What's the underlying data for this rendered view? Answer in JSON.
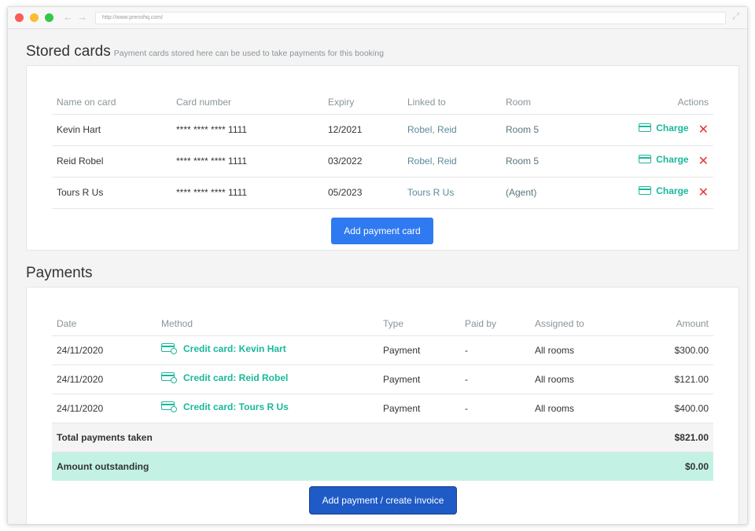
{
  "browser": {
    "url": "http://www.prenohq.com/"
  },
  "stored_cards": {
    "title": "Stored cards",
    "subtitle": "Payment cards stored here can be used to take payments for this booking",
    "columns": [
      "Name on card",
      "Card number",
      "Expiry",
      "Linked to",
      "Room",
      "Actions"
    ],
    "rows": [
      {
        "name": "Kevin Hart",
        "number": "**** **** **** 1111",
        "expiry": "12/2021",
        "linked": "Robel, Reid",
        "room": "Room 5",
        "charge": "Charge"
      },
      {
        "name": "Reid Robel",
        "number": "**** **** **** 1111",
        "expiry": "03/2022",
        "linked": "Robel, Reid",
        "room": "Room 5",
        "charge": "Charge"
      },
      {
        "name": "Tours R Us",
        "number": "**** **** **** 1111",
        "expiry": "05/2023",
        "linked": "Tours R Us",
        "room": "(Agent)",
        "charge": "Charge"
      }
    ],
    "add_button": "Add payment card"
  },
  "payments": {
    "title": "Payments",
    "columns": [
      "Date",
      "Method",
      "Type",
      "Paid by",
      "Assigned to",
      "Amount"
    ],
    "rows": [
      {
        "date": "24/11/2020",
        "method": "Credit card: Kevin Hart",
        "type": "Payment",
        "paid_by": "-",
        "assigned": "All rooms",
        "amount": "$300.00"
      },
      {
        "date": "24/11/2020",
        "method": "Credit card: Reid Robel",
        "type": "Payment",
        "paid_by": "-",
        "assigned": "All rooms",
        "amount": "$121.00"
      },
      {
        "date": "24/11/2020",
        "method": "Credit card: Tours R Us",
        "type": "Payment",
        "paid_by": "-",
        "assigned": "All rooms",
        "amount": "$400.00"
      }
    ],
    "total_label": "Total payments taken",
    "total_value": "$821.00",
    "outstanding_label": "Amount outstanding",
    "outstanding_value": "$0.00",
    "add_button": "Add payment / create invoice"
  },
  "colors": {
    "accent_green": "#19b89a",
    "primary_blue": "#2f7af0",
    "delete_red": "#e8343a",
    "outstanding_bg": "#c3f2e5"
  }
}
